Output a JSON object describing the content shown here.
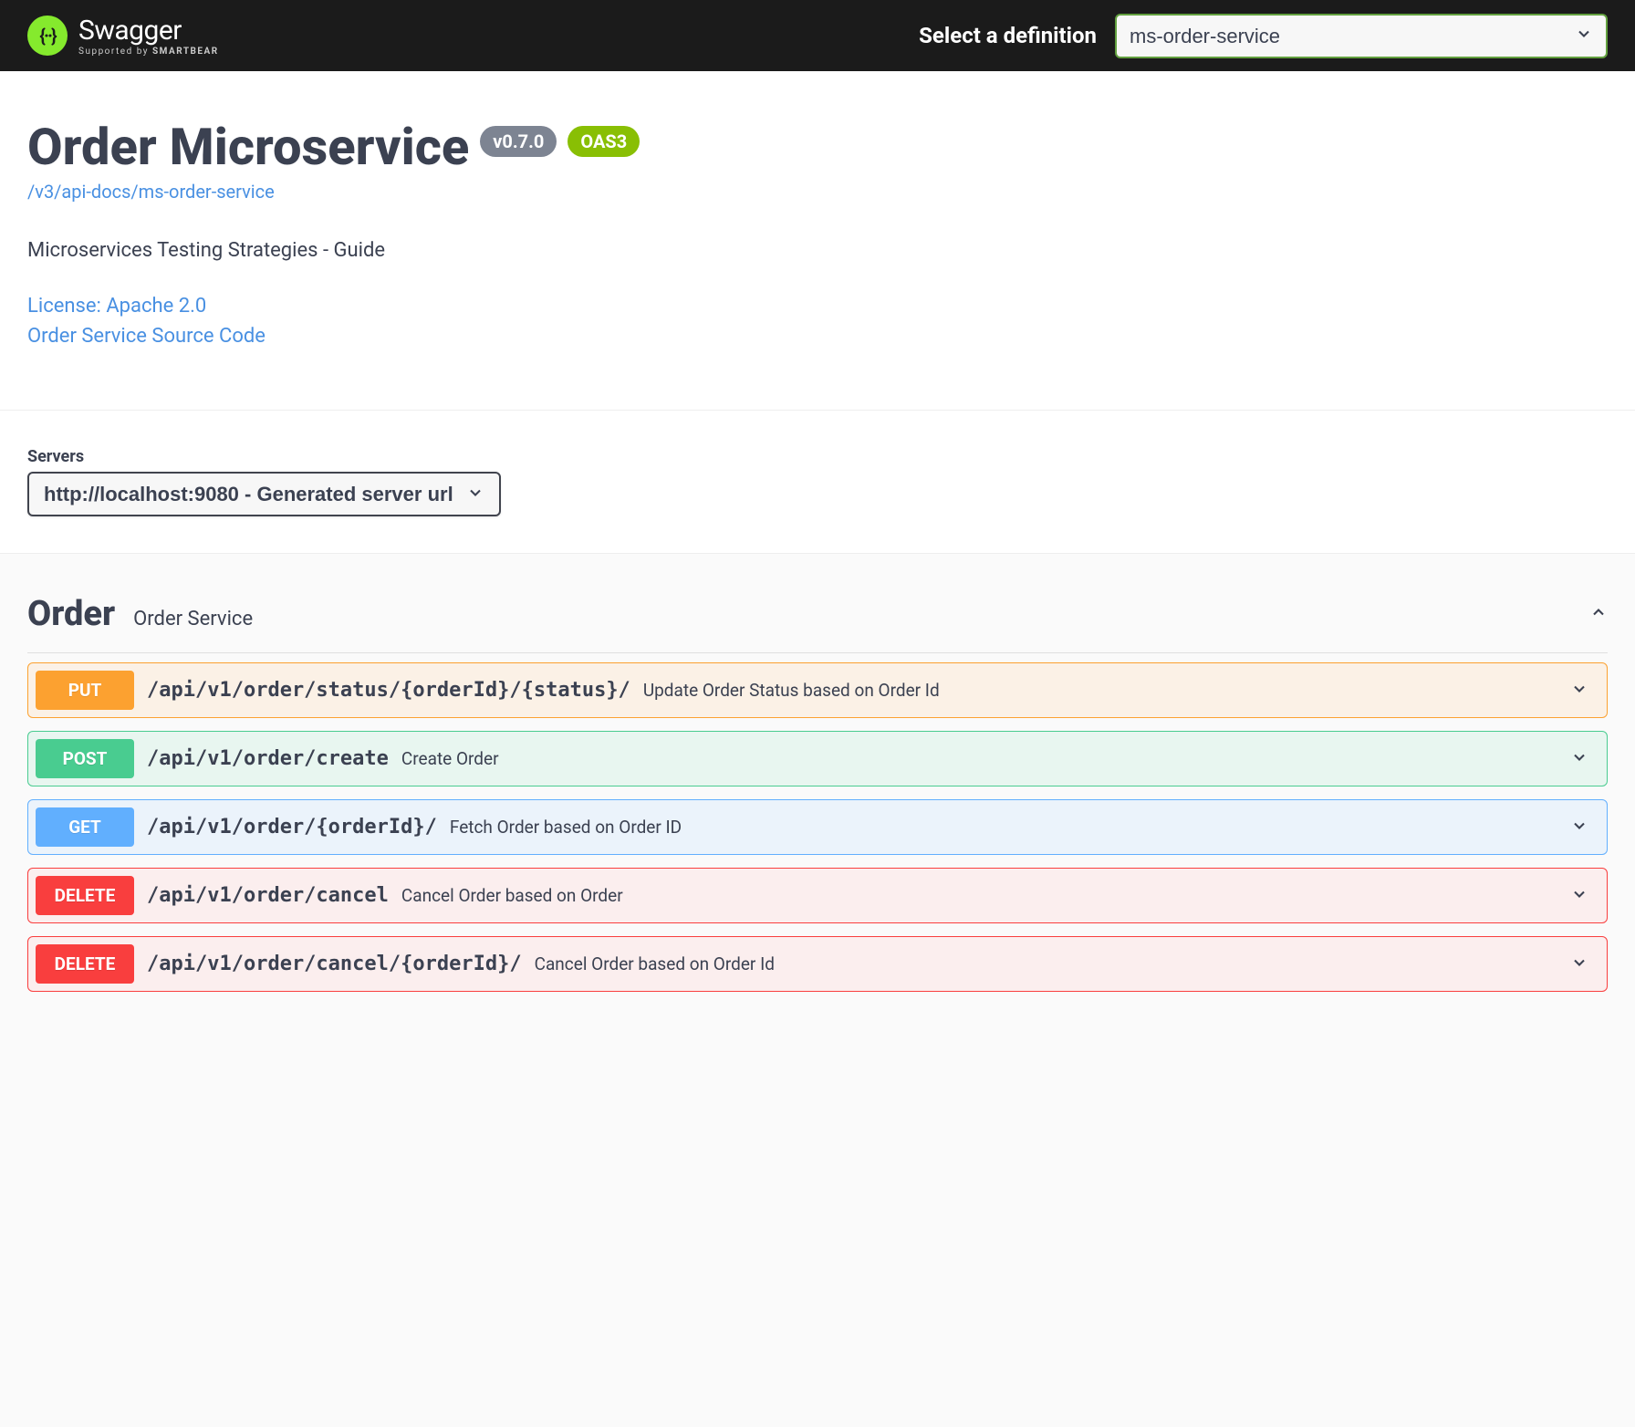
{
  "topbar": {
    "brand": "Swagger",
    "supported_prefix": "Supported by ",
    "supported_brand": "SMARTBEAR",
    "definition_label": "Select a definition",
    "definition_selected": "ms-order-service"
  },
  "info": {
    "title": "Order Microservice",
    "version_badge": "v0.7.0",
    "oas_badge": "OAS3",
    "api_docs_path": "/v3/api-docs/ms-order-service",
    "description": "Microservices Testing Strategies - Guide",
    "license_label": "License: Apache 2.0",
    "source_code_label": "Order Service Source Code"
  },
  "servers": {
    "label": "Servers",
    "selected": "http://localhost:9080 - Generated server url"
  },
  "tag": {
    "name": "Order",
    "description": "Order Service"
  },
  "operations": [
    {
      "method": "PUT",
      "method_class": "put",
      "path": "/api/v1/order/status/{orderId}/{status}/",
      "summary": "Update Order Status based on Order Id"
    },
    {
      "method": "POST",
      "method_class": "post",
      "path": "/api/v1/order/create",
      "summary": "Create Order"
    },
    {
      "method": "GET",
      "method_class": "get",
      "path": "/api/v1/order/{orderId}/",
      "summary": "Fetch Order based on Order ID"
    },
    {
      "method": "DELETE",
      "method_class": "delete",
      "path": "/api/v1/order/cancel",
      "summary": "Cancel Order based on Order"
    },
    {
      "method": "DELETE",
      "method_class": "delete",
      "path": "/api/v1/order/cancel/{orderId}/",
      "summary": "Cancel Order based on Order Id"
    }
  ]
}
